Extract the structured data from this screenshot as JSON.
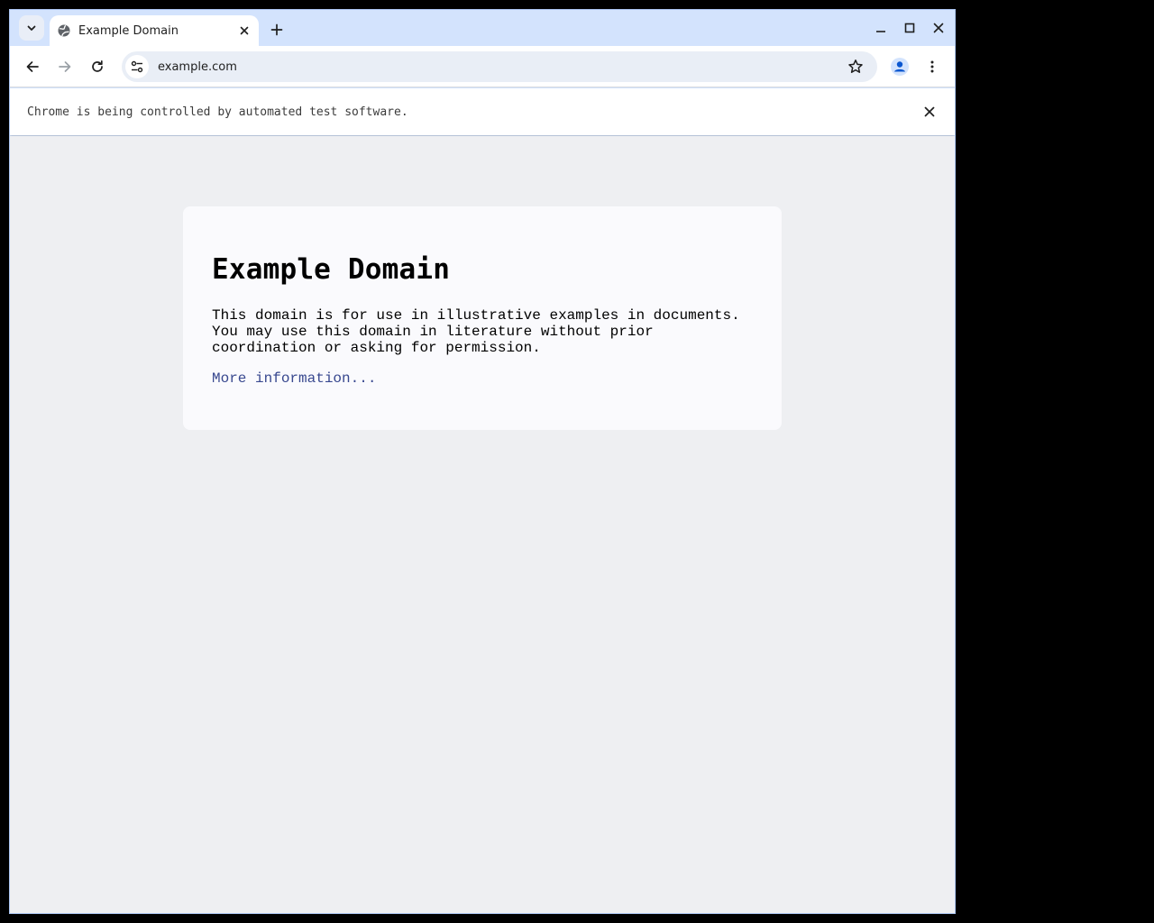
{
  "browser": {
    "tab": {
      "title": "Example Domain",
      "favicon": "globe-icon"
    },
    "toolbar": {
      "url": "example.com"
    },
    "infobar": {
      "message": "Chrome is being controlled by automated test software."
    },
    "colors": {
      "frame": "#d3e3fd",
      "omnibox": "#e9eef6",
      "page_background": "#eeeff2",
      "link": "#38488f",
      "profile_accent": "#0b57d0"
    }
  },
  "page": {
    "heading": "Example Domain",
    "paragraph": "This domain is for use in illustrative examples in documents. You may use this domain in literature without prior coordination or asking for permission.",
    "link_text": "More information..."
  }
}
